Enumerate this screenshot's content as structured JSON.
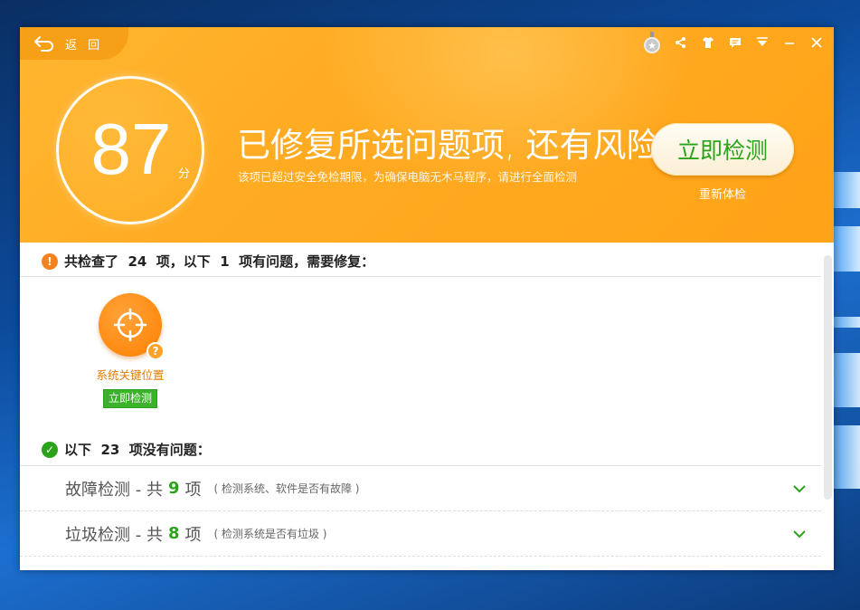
{
  "colors": {
    "header_orange": "#ffab22",
    "accent_green": "#2aa31a",
    "warning_orange": "#f5821f",
    "issue_text": "#e07b00"
  },
  "header": {
    "back_label": "返 回",
    "toolbar_icons": [
      "medal-icon",
      "share-icon",
      "skin-icon",
      "feedback-icon",
      "menu-icon",
      "minimize-icon",
      "close-icon"
    ],
    "score": "87",
    "score_unit": "分",
    "headline": "已修复所选问题项, 还有风险",
    "subline": "该项已超过安全免检期限，为确保电脑无木马程序，请进行全面检测",
    "scan_button": "立即检测",
    "recheck_link": "重新体检"
  },
  "problems": {
    "title": "共检查了  24  项，以下  1  项有问题，需要修复：",
    "items": [
      {
        "label": "系统关键位置",
        "action": "立即检测",
        "icon": "crosshair-icon"
      }
    ]
  },
  "ok": {
    "title": "以下  23  项没有问题：",
    "categories": [
      {
        "name": "故障检测 - 共",
        "count": "9",
        "unit": "项",
        "desc": "( 检测系统、软件是否有故障 )"
      },
      {
        "name": "垃圾检测 - 共",
        "count": "8",
        "unit": "项",
        "desc": "( 检测系统是否有垃圾 )"
      }
    ]
  }
}
